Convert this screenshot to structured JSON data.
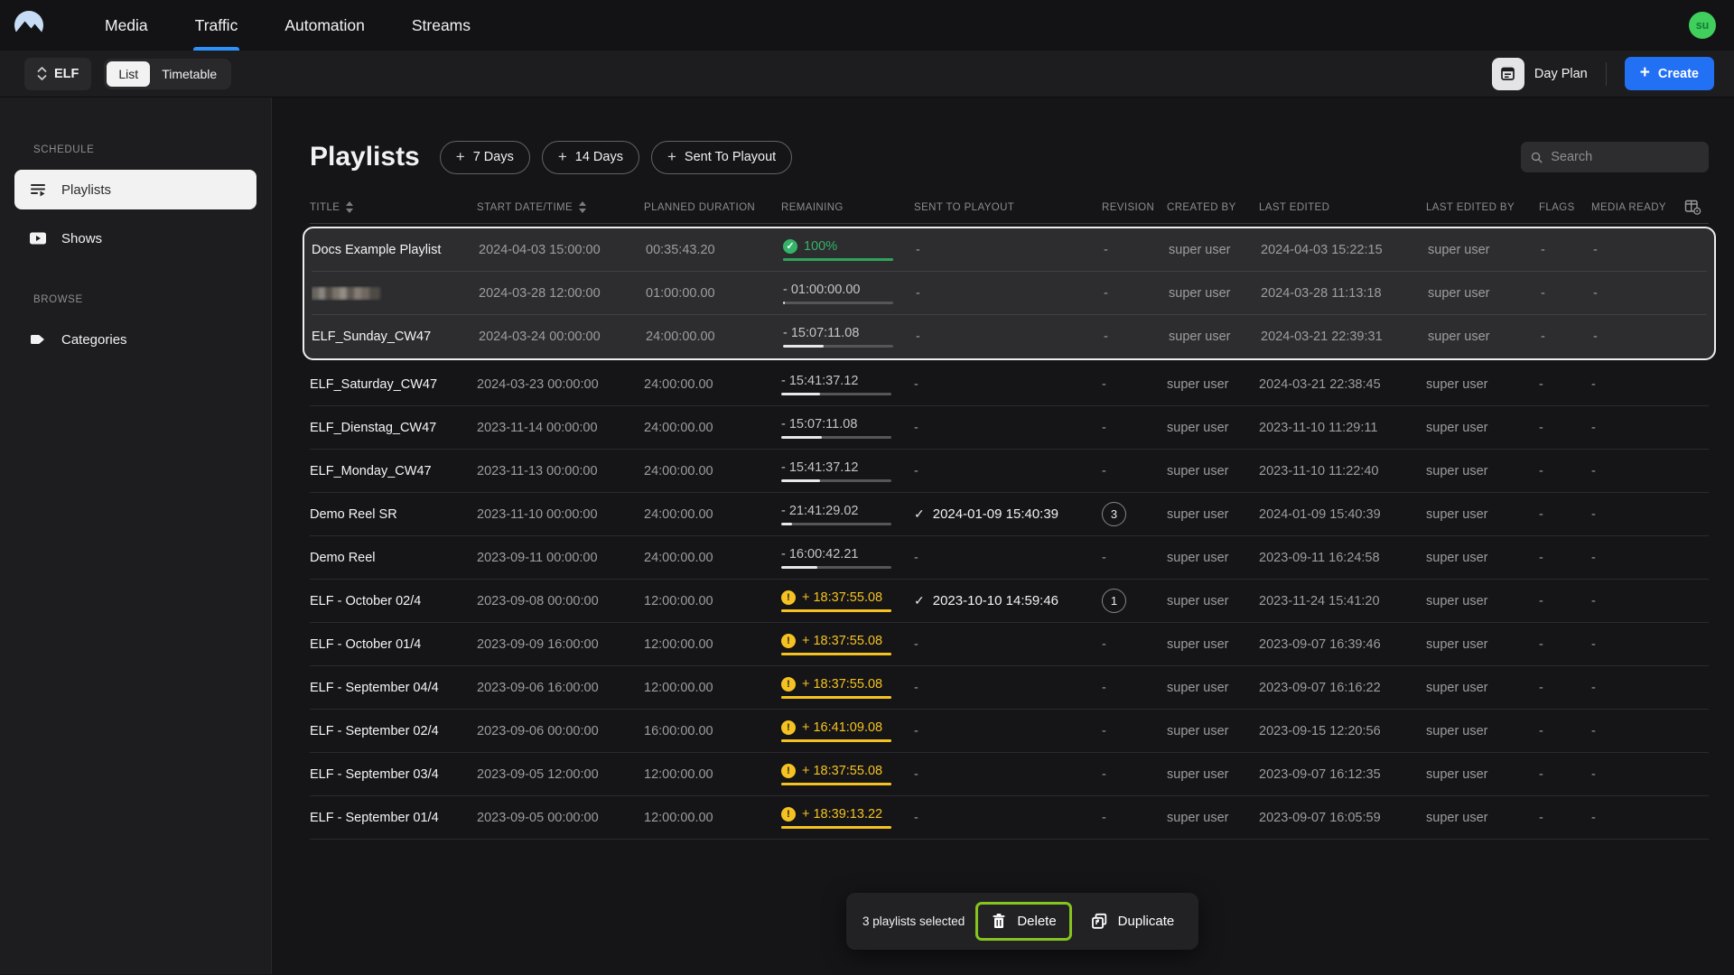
{
  "colors": {
    "accent_blue": "#2e90fa",
    "create_blue": "#2270f4",
    "green": "#35b368",
    "amber": "#f5c221",
    "lime": "#86c41e",
    "avatar_green": "#40ce5c"
  },
  "icons": {
    "plus": "+",
    "check": "✓",
    "warning_mark": "!",
    "dash": "-"
  },
  "nav": {
    "items": [
      {
        "label": "Media"
      },
      {
        "label": "Traffic"
      },
      {
        "label": "Automation"
      },
      {
        "label": "Streams"
      }
    ],
    "active_index": 1,
    "avatar": "su"
  },
  "toolbar": {
    "channel": "ELF",
    "view_toggle": [
      {
        "label": "List",
        "active": true
      },
      {
        "label": "Timetable",
        "active": false
      }
    ],
    "day_plan_label": "Day Plan",
    "create_label": "Create"
  },
  "sidebar": {
    "sections": [
      {
        "label": "SCHEDULE",
        "items": [
          {
            "label": "Playlists",
            "icon": "playlist-icon",
            "active": true
          },
          {
            "label": "Shows",
            "icon": "shows-icon",
            "active": false
          }
        ]
      },
      {
        "label": "BROWSE",
        "items": [
          {
            "label": "Categories",
            "icon": "category-icon",
            "active": false
          }
        ]
      }
    ]
  },
  "content": {
    "title": "Playlists",
    "filters": [
      {
        "label": "7 Days"
      },
      {
        "label": "14 Days"
      },
      {
        "label": "Sent To Playout"
      }
    ],
    "search": {
      "placeholder": "Search"
    },
    "table": {
      "columns": [
        {
          "label": "TITLE",
          "sortable": true
        },
        {
          "label": "START DATE/TIME",
          "sortable": true
        },
        {
          "label": "PLANNED DURATION",
          "sortable": false
        },
        {
          "label": "REMAINING",
          "sortable": false
        },
        {
          "label": "SENT TO PLAYOUT",
          "sortable": false
        },
        {
          "label": "REVISION",
          "sortable": false
        },
        {
          "label": "CREATED BY",
          "sortable": false
        },
        {
          "label": "LAST EDITED",
          "sortable": false
        },
        {
          "label": "LAST EDITED BY",
          "sortable": false
        },
        {
          "label": "FLAGS",
          "sortable": false
        },
        {
          "label": "MEDIA READY",
          "sortable": false
        }
      ],
      "rows": [
        {
          "title": "Docs Example Playlist",
          "redacted": false,
          "selected": true,
          "start": "2024-04-03 15:00:00",
          "planned": "00:35:43.20",
          "remaining": {
            "state": "complete",
            "text": "100%",
            "progress": 100
          },
          "sent": null,
          "revision": null,
          "created_by": "super user",
          "last_edited": "2024-04-03 15:22:15",
          "last_edited_by": "super user",
          "flags": "-",
          "media_ready": "-"
        },
        {
          "title": "",
          "redacted": true,
          "selected": true,
          "start": "2024-03-28 12:00:00",
          "planned": "01:00:00.00",
          "remaining": {
            "state": "countdown",
            "text": "- 01:00:00.00",
            "progress": 2
          },
          "sent": null,
          "revision": null,
          "created_by": "super user",
          "last_edited": "2024-03-28 11:13:18",
          "last_edited_by": "super user",
          "flags": "-",
          "media_ready": "-"
        },
        {
          "title": "ELF_Sunday_CW47",
          "redacted": false,
          "selected": true,
          "start": "2024-03-24 00:00:00",
          "planned": "24:00:00.00",
          "remaining": {
            "state": "countdown",
            "text": "- 15:07:11.08",
            "progress": 37
          },
          "sent": null,
          "revision": null,
          "created_by": "super user",
          "last_edited": "2024-03-21 22:39:31",
          "last_edited_by": "super user",
          "flags": "-",
          "media_ready": "-"
        },
        {
          "title": "ELF_Saturday_CW47",
          "redacted": false,
          "selected": false,
          "start": "2024-03-23 00:00:00",
          "planned": "24:00:00.00",
          "remaining": {
            "state": "countdown",
            "text": "- 15:41:37.12",
            "progress": 35
          },
          "sent": null,
          "revision": null,
          "created_by": "super user",
          "last_edited": "2024-03-21 22:38:45",
          "last_edited_by": "super user",
          "flags": "-",
          "media_ready": "-"
        },
        {
          "title": "ELF_Dienstag_CW47",
          "redacted": false,
          "selected": false,
          "start": "2023-11-14 00:00:00",
          "planned": "24:00:00.00",
          "remaining": {
            "state": "countdown",
            "text": "- 15:07:11.08",
            "progress": 37
          },
          "sent": null,
          "revision": null,
          "created_by": "super user",
          "last_edited": "2023-11-10 11:29:11",
          "last_edited_by": "super user",
          "flags": "-",
          "media_ready": "-"
        },
        {
          "title": "ELF_Monday_CW47",
          "redacted": false,
          "selected": false,
          "start": "2023-11-13 00:00:00",
          "planned": "24:00:00.00",
          "remaining": {
            "state": "countdown",
            "text": "- 15:41:37.12",
            "progress": 35
          },
          "sent": null,
          "revision": null,
          "created_by": "super user",
          "last_edited": "2023-11-10 11:22:40",
          "last_edited_by": "super user",
          "flags": "-",
          "media_ready": "-"
        },
        {
          "title": "Demo Reel SR",
          "redacted": false,
          "selected": false,
          "start": "2023-11-10 00:00:00",
          "planned": "24:00:00.00",
          "remaining": {
            "state": "countdown",
            "text": "- 21:41:29.02",
            "progress": 10
          },
          "sent": "2024-01-09 15:40:39",
          "revision": "3",
          "created_by": "super user",
          "last_edited": "2024-01-09 15:40:39",
          "last_edited_by": "super user",
          "flags": "-",
          "media_ready": "-"
        },
        {
          "title": "Demo Reel",
          "redacted": false,
          "selected": false,
          "start": "2023-09-11 00:00:00",
          "planned": "24:00:00.00",
          "remaining": {
            "state": "countdown",
            "text": "- 16:00:42.21",
            "progress": 33
          },
          "sent": null,
          "revision": null,
          "created_by": "super user",
          "last_edited": "2023-09-11 16:24:58",
          "last_edited_by": "super user",
          "flags": "-",
          "media_ready": "-"
        },
        {
          "title": "ELF - October 02/4",
          "redacted": false,
          "selected": false,
          "start": "2023-09-08 00:00:00",
          "planned": "12:00:00.00",
          "remaining": {
            "state": "overrun",
            "text": "+ 18:37:55.08",
            "progress": 100
          },
          "sent": "2023-10-10 14:59:46",
          "revision": "1",
          "created_by": "super user",
          "last_edited": "2023-11-24 15:41:20",
          "last_edited_by": "super user",
          "flags": "-",
          "media_ready": "-"
        },
        {
          "title": "ELF - October 01/4",
          "redacted": false,
          "selected": false,
          "start": "2023-09-09 16:00:00",
          "planned": "12:00:00.00",
          "remaining": {
            "state": "overrun",
            "text": "+ 18:37:55.08",
            "progress": 100
          },
          "sent": null,
          "revision": null,
          "created_by": "super user",
          "last_edited": "2023-09-07 16:39:46",
          "last_edited_by": "super user",
          "flags": "-",
          "media_ready": "-"
        },
        {
          "title": "ELF - September 04/4",
          "redacted": false,
          "selected": false,
          "start": "2023-09-06 16:00:00",
          "planned": "12:00:00.00",
          "remaining": {
            "state": "overrun",
            "text": "+ 18:37:55.08",
            "progress": 100
          },
          "sent": null,
          "revision": null,
          "created_by": "super user",
          "last_edited": "2023-09-07 16:16:22",
          "last_edited_by": "super user",
          "flags": "-",
          "media_ready": "-"
        },
        {
          "title": "ELF - September 02/4",
          "redacted": false,
          "selected": false,
          "start": "2023-09-06 00:00:00",
          "planned": "16:00:00.00",
          "remaining": {
            "state": "overrun",
            "text": "+ 16:41:09.08",
            "progress": 100
          },
          "sent": null,
          "revision": null,
          "created_by": "super user",
          "last_edited": "2023-09-15 12:20:56",
          "last_edited_by": "super user",
          "flags": "-",
          "media_ready": "-"
        },
        {
          "title": "ELF - September 03/4",
          "redacted": false,
          "selected": false,
          "start": "2023-09-05 12:00:00",
          "planned": "12:00:00.00",
          "remaining": {
            "state": "overrun",
            "text": "+ 18:37:55.08",
            "progress": 100
          },
          "sent": null,
          "revision": null,
          "created_by": "super user",
          "last_edited": "2023-09-07 16:12:35",
          "last_edited_by": "super user",
          "flags": "-",
          "media_ready": "-"
        },
        {
          "title": "ELF - September 01/4",
          "redacted": false,
          "selected": false,
          "start": "2023-09-05 00:00:00",
          "planned": "12:00:00.00",
          "remaining": {
            "state": "overrun",
            "text": "+ 18:39:13.22",
            "progress": 100
          },
          "sent": null,
          "revision": null,
          "created_by": "super user",
          "last_edited": "2023-09-07 16:05:59",
          "last_edited_by": "super user",
          "flags": "-",
          "media_ready": "-"
        }
      ]
    },
    "selection_bar": {
      "count_text": "3 playlists selected",
      "delete_label": "Delete",
      "duplicate_label": "Duplicate"
    }
  }
}
